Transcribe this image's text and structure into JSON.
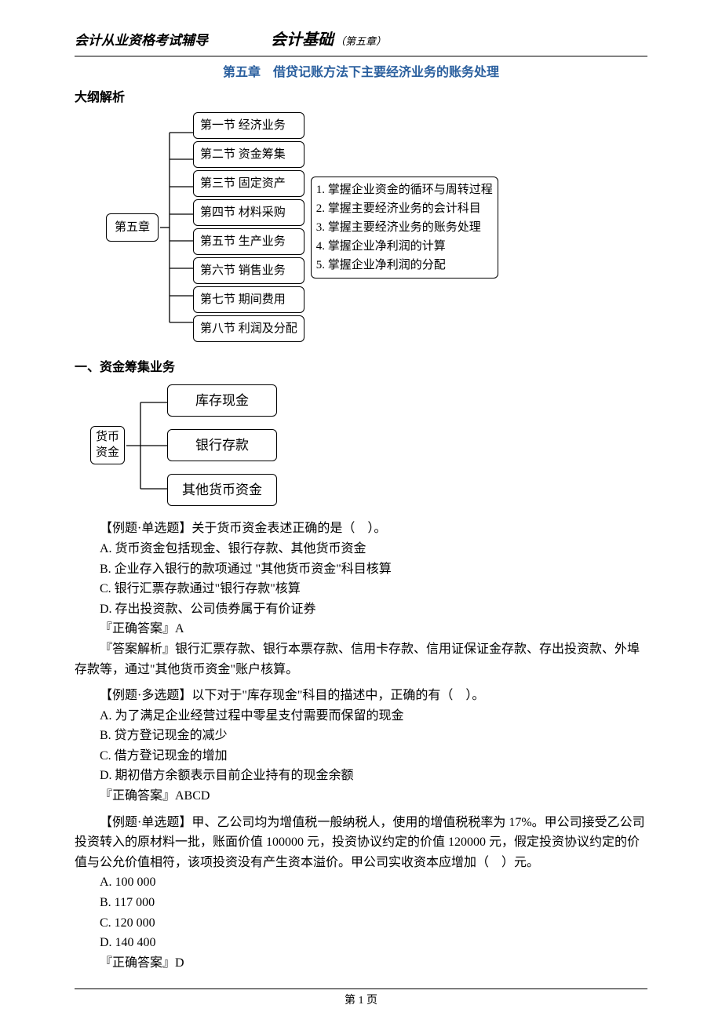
{
  "header": {
    "left": "会计从业资格考试辅导",
    "mid": "会计基础",
    "sub": "（第五章）"
  },
  "chapter_title": "第五章　借贷记账方法下主要经济业务的账务处理",
  "outline_heading": "大纲解析",
  "diagram1": {
    "root": "第五章",
    "sections": [
      "第一节  经济业务",
      "第二节  资金筹集",
      "第三节  固定资产",
      "第四节  材料采购",
      "第五节  生产业务",
      "第六节  销售业务",
      "第七节  期间费用",
      "第八节  利润及分配"
    ],
    "objectives": [
      "1. 掌握企业资金的循环与周转过程",
      "2. 掌握主要经济业务的会计科目",
      "3. 掌握主要经济业务的账务处理",
      "4. 掌握企业净利润的计算",
      "5. 掌握企业净利润的分配"
    ]
  },
  "section1_heading": "一、资金筹集业务",
  "diagram2": {
    "root_line1": "货币",
    "root_line2": "资金",
    "items": [
      "库存现金",
      "银行存款",
      "其他货币资金"
    ]
  },
  "q1": {
    "stem": "【例题·单选题】关于货币资金表述正确的是（　）。",
    "a": "A. 货币资金包括现金、银行存款、其他货币资金",
    "b": "B. 企业存入银行的款项通过 \"其他货币资金\"科目核算",
    "c": "C. 银行汇票存款通过\"银行存款\"核算",
    "d": "D. 存出投资款、公司债券属于有价证券",
    "ans": "『正确答案』A",
    "exp": "『答案解析』银行汇票存款、银行本票存款、信用卡存款、信用证保证金存款、存出投资款、外埠存款等，通过\"其他货币资金\"账户核算。"
  },
  "q2": {
    "stem": "【例题·多选题】以下对于\"库存现金\"科目的描述中，正确的有（　）。",
    "a": "A. 为了满足企业经营过程中零星支付需要而保留的现金",
    "b": "B. 贷方登记现金的减少",
    "c": "C. 借方登记现金的增加",
    "d": "D. 期初借方余额表示目前企业持有的现金余额",
    "ans": "『正确答案』ABCD"
  },
  "q3": {
    "stem": "【例题·单选题】甲、乙公司均为增值税一般纳税人，使用的增值税税率为 17%。甲公司接受乙公司投资转入的原材料一批，账面价值 100000 元，投资协议约定的价值 120000 元，假定投资协议约定的价值与公允价值相符，该项投资没有产生资本溢价。甲公司实收资本应增加（　）元。",
    "a": "A. 100 000",
    "b": "B. 117 000",
    "c": "C. 120 000",
    "d": "D. 140 400",
    "ans": "『正确答案』D"
  },
  "footer": "第 1 页"
}
